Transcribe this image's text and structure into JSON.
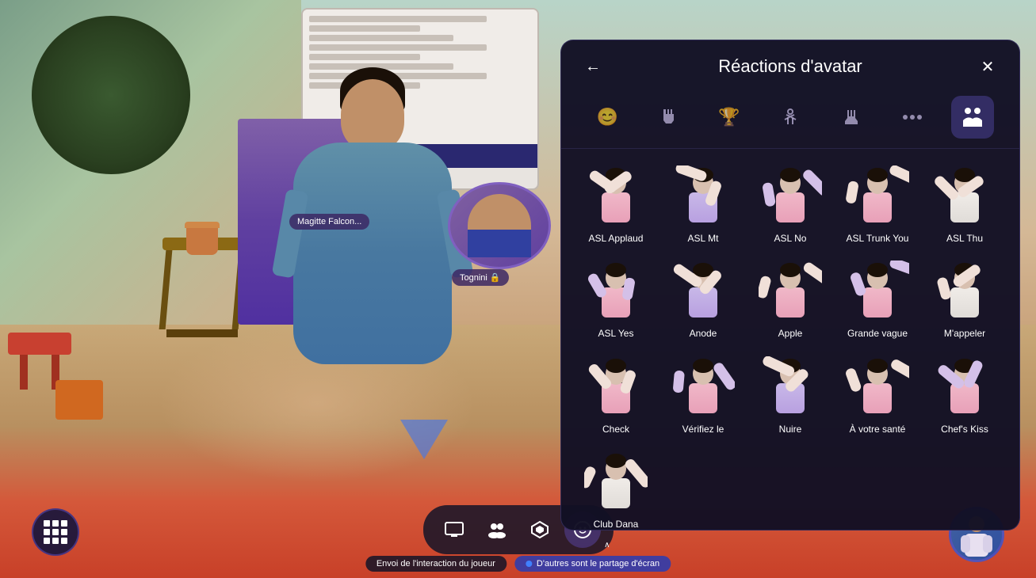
{
  "scene": {
    "background_description": "3D virtual meeting room with beige/sandy floor, trees, furniture"
  },
  "panel": {
    "title": "Réactions d'avatar",
    "back_label": "←",
    "close_label": "✕"
  },
  "categories": [
    {
      "id": "emoji",
      "icon": "😊",
      "active": false
    },
    {
      "id": "hands",
      "icon": "🤲",
      "active": false
    },
    {
      "id": "trophy",
      "icon": "🏆",
      "active": false
    },
    {
      "id": "activity",
      "icon": "🏃",
      "active": false
    },
    {
      "id": "gesture",
      "icon": "👋",
      "active": false
    },
    {
      "id": "more",
      "icon": "···",
      "active": false
    },
    {
      "id": "selected",
      "icon": "👥",
      "active": true
    }
  ],
  "reactions": [
    {
      "id": 1,
      "label": "ASL Applaud",
      "arm_left_rot": "-60",
      "arm_right_rot": "20",
      "shirt": "pink"
    },
    {
      "id": 2,
      "label": "ASL Mt",
      "arm_left_rot": "-80",
      "arm_right_rot": "30",
      "shirt": "purple"
    },
    {
      "id": 3,
      "label": "ASL No",
      "arm_left_rot": "-20",
      "arm_right_rot": "-40",
      "shirt": "pink"
    },
    {
      "id": 4,
      "label": "ASL Trunk You",
      "arm_left_rot": "10",
      "arm_right_rot": "-70",
      "shirt": "pink"
    },
    {
      "id": 5,
      "label": "ASL Thu",
      "arm_left_rot": "-50",
      "arm_right_rot": "60",
      "shirt": "white"
    },
    {
      "id": 6,
      "label": "ASL Yes",
      "arm_left_rot": "-30",
      "arm_right_rot": "10",
      "shirt": "pink"
    },
    {
      "id": 7,
      "label": "Anode",
      "arm_left_rot": "-40",
      "arm_right_rot": "40",
      "shirt": "purple"
    },
    {
      "id": 8,
      "label": "Apple",
      "arm_left_rot": "20",
      "arm_right_rot": "-50",
      "shirt": "pink"
    },
    {
      "id": 9,
      "label": "Grande vague",
      "arm_left_rot": "-70",
      "arm_right_rot": "30",
      "shirt": "pink"
    },
    {
      "id": 10,
      "label": "M'appeler",
      "arm_left_rot": "-20",
      "arm_right_rot": "60",
      "shirt": "white"
    },
    {
      "id": 11,
      "label": "Check",
      "arm_left_rot": "-40",
      "arm_right_rot": "20",
      "shirt": "pink"
    },
    {
      "id": 12,
      "label": "Vérifiez le",
      "arm_left_rot": "10",
      "arm_right_rot": "-30",
      "shirt": "pink"
    },
    {
      "id": 13,
      "label": "Nuire",
      "arm_left_rot": "-60",
      "arm_right_rot": "50",
      "shirt": "purple"
    },
    {
      "id": 14,
      "label": "À votre santé",
      "arm_left_rot": "-20",
      "arm_right_rot": "-60",
      "shirt": "pink"
    },
    {
      "id": 15,
      "label": "Chef's Kiss",
      "arm_left_rot": "-80",
      "arm_right_rot": "20",
      "shirt": "pink"
    },
    {
      "id": 16,
      "label": "Club Dana",
      "arm_left_rot": "30",
      "arm_right_rot": "-40",
      "shirt": "white"
    }
  ],
  "toolbar": {
    "buttons": [
      {
        "id": "screen",
        "icon": "⬜",
        "label": "Écran"
      },
      {
        "id": "people",
        "icon": "⚬⚬",
        "label": "Personnes"
      },
      {
        "id": "apps",
        "icon": "⬡",
        "label": "Applications"
      },
      {
        "id": "emoji",
        "icon": "🙂",
        "label": "Émojis"
      }
    ]
  },
  "status_bar": {
    "left_text": "Envoi de l'interaction du joueur",
    "right_text": "D'autres sont le partage d'écran"
  },
  "name_tags": {
    "left": "Magitte Falcon...",
    "right": "Tognini 🔒"
  }
}
